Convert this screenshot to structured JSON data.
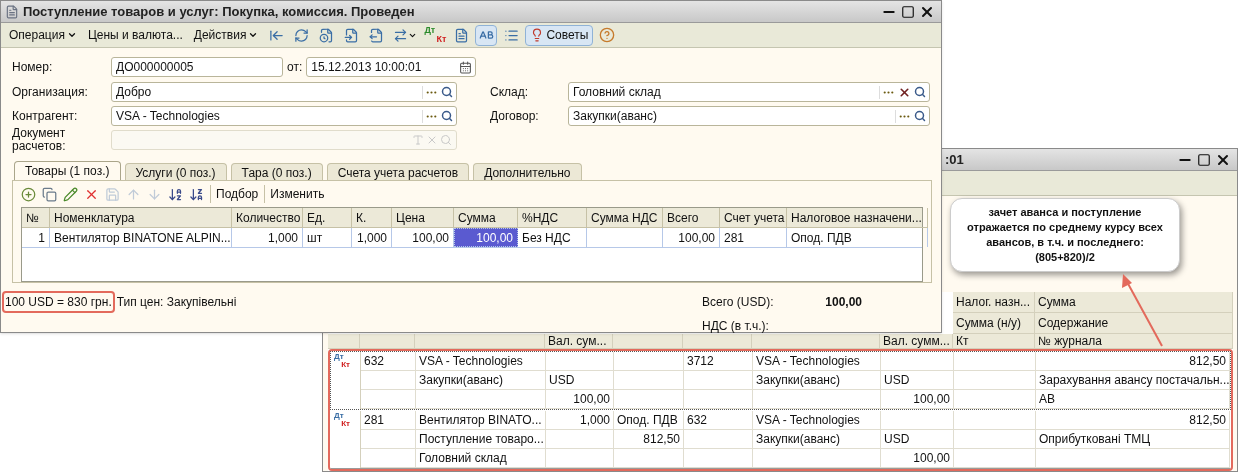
{
  "main_window": {
    "title": "Поступление товаров и услуг: Покупка, комиссия. Проведен",
    "toolbar": [
      {
        "kind": "menu",
        "label": "Операция"
      },
      {
        "kind": "button",
        "label": "Цены и валюта..."
      },
      {
        "kind": "menu",
        "label": "Действия"
      },
      {
        "kind": "icon",
        "pressed": false
      },
      {
        "kind": "icon",
        "pressed": false
      },
      {
        "kind": "icon",
        "pressed": false
      },
      {
        "kind": "icon",
        "pressed": false
      },
      {
        "kind": "icon",
        "pressed": false
      },
      {
        "kind": "icon-menu",
        "pressed": false
      },
      {
        "kind": "dtkt",
        "debit": "Дт",
        "credit": "Кт",
        "pressed": false
      },
      {
        "kind": "icon",
        "pressed": false
      },
      {
        "kind": "icon",
        "pressed": true
      },
      {
        "kind": "icon",
        "pressed": false
      },
      {
        "kind": "tips",
        "label": "Советы",
        "pressed": true
      },
      {
        "kind": "help",
        "pressed": false
      }
    ],
    "number": {
      "label": "Номер:",
      "value": "ДО000000005",
      "date_label": "от:",
      "date": "15.12.2013 10:00:01"
    },
    "left_fields": [
      {
        "label": "Организация:",
        "value": "Добро",
        "disabled": false
      },
      {
        "label": "Контрагент:",
        "value": "VSA - Technologies",
        "disabled": false
      },
      {
        "label": "Документ расчетов:",
        "disabled": true
      }
    ],
    "right_fields": [
      {
        "label": "Склад:",
        "value": "Головний склад",
        "clearable": true
      },
      {
        "label": "Договор:",
        "value": "Закупки(аванс)",
        "clearable": false
      }
    ],
    "tabs": [
      {
        "label": "Товары (1 поз.)",
        "selected": true
      },
      {
        "label": "Услуги (0 поз.)",
        "selected": false
      },
      {
        "label": "Тара (0 поз.)",
        "selected": false
      },
      {
        "label": "Счета учета расчетов",
        "selected": false
      },
      {
        "label": "Дополнительно",
        "selected": false
      }
    ],
    "tab_toolbar": {
      "icons": [
        {
          "disabled": false
        },
        {
          "disabled": false
        },
        {
          "disabled": false
        },
        {
          "disabled": false
        },
        {
          "disabled": true
        },
        {
          "disabled": true
        },
        {
          "disabled": true
        },
        {
          "disabled": false
        },
        {
          "disabled": false
        }
      ],
      "buttons": [
        "Подбор",
        "Изменить"
      ]
    },
    "table": {
      "columns": [
        "№",
        "Номенклатура",
        "Количество",
        "Ед.",
        "К.",
        "Цена",
        "Сумма",
        "%НДС",
        "Сумма НДС",
        "Всего",
        "Счет учета",
        "Налоговое назначени..."
      ],
      "rows": [
        {
          "cells": [
            {
              "text": "1",
              "selected": false
            },
            {
              "text": "Вентилятор BINATONE ALPIN...",
              "selected": false
            },
            {
              "text": "1,000",
              "selected": false
            },
            {
              "text": "шт",
              "selected": false
            },
            {
              "text": "1,000",
              "selected": false
            },
            {
              "text": "100,00",
              "selected": false
            },
            {
              "text": "100,00",
              "selected": true
            },
            {
              "text": "Без НДС",
              "selected": false
            },
            {
              "selected": false
            },
            {
              "text": "100,00",
              "selected": false
            },
            {
              "text": "281",
              "selected": false
            },
            {
              "text": "Опод. ПДВ",
              "selected": false
            }
          ]
        }
      ]
    },
    "rate": {
      "text": "100 USD = 830 грн.",
      "highlighted": true
    },
    "price_type": "Тип цен: Закупівельні",
    "total_label": "Всего (USD):",
    "total": "100,00",
    "vat_label": "НДС (в т.ч.):"
  },
  "back_window": {
    "title": ":01",
    "header_rows": [
      {
        "column_9": "Налог. назн...",
        "column_10": "Сумма"
      },
      {
        "column_9": "Сумма (н/у)",
        "column_10": "Содержание"
      },
      {
        "column_4": "Вал. сум...",
        "column_8": "Вал. сумм...",
        "column_9": "Кт",
        "column_10": "№ журнала"
      }
    ],
    "entries": [
      {
        "selected": true,
        "debit_mark": "Дт",
        "credit_mark": "Кт",
        "lines": [
          {
            "column_2": {
              "text": "632",
              "kind": "text"
            },
            "column_3": {
              "text": "VSA - Technologies",
              "kind": "text"
            },
            "column_6": {
              "text": "3712",
              "kind": "text"
            },
            "column_7": {
              "text": "VSA - Technologies",
              "kind": "text"
            },
            "column_10": {
              "text": "812,50",
              "kind": "amount"
            }
          },
          {
            "column_3": {
              "text": "Закупки(аванс)",
              "kind": "text"
            },
            "column_4": {
              "text": "USD",
              "kind": "text"
            },
            "column_7": {
              "text": "Закупки(аванс)",
              "kind": "text"
            },
            "column_8": {
              "text": "USD",
              "kind": "text"
            },
            "column_10": {
              "text": "Зарахування авансу постачальн...",
              "kind": "text"
            }
          },
          {
            "column_4": {
              "text": "100,00",
              "kind": "amount"
            },
            "column_8": {
              "text": "100,00",
              "kind": "amount"
            },
            "column_10": {
              "text": "АВ",
              "kind": "text"
            }
          }
        ]
      },
      {
        "selected": false,
        "debit_mark": "Дт",
        "credit_mark": "Кт",
        "lines": [
          {
            "column_2": {
              "text": "281",
              "kind": "text"
            },
            "column_3": {
              "text": "Вентилятор BINATO...",
              "kind": "text"
            },
            "column_4": {
              "text": "1,000",
              "kind": "amount"
            },
            "column_5": {
              "text": "Опод. ПДВ",
              "kind": "text"
            },
            "column_6": {
              "text": "632",
              "kind": "text"
            },
            "column_7": {
              "text": "VSA - Technologies",
              "kind": "text"
            },
            "column_10": {
              "text": "812,50",
              "kind": "amount"
            }
          },
          {
            "column_3": {
              "text": "Поступление товаро...",
              "kind": "text"
            },
            "column_5": {
              "text": "812,50",
              "kind": "amount"
            },
            "column_7": {
              "text": "Закупки(аванс)",
              "kind": "text"
            },
            "column_8": {
              "text": "USD",
              "kind": "text"
            },
            "column_10": {
              "text": "Оприбутковані ТМЦ",
              "kind": "text"
            }
          },
          {
            "column_3": {
              "text": "Головний склад",
              "kind": "text"
            },
            "column_8": {
              "text": "100,00",
              "kind": "amount"
            }
          }
        ]
      }
    ],
    "highlighted": true
  },
  "callout": {
    "text": "зачет аванса и поступление отражается по среднему курсу всех авансов, в т.ч. и последнего: (805+820)/2"
  }
}
